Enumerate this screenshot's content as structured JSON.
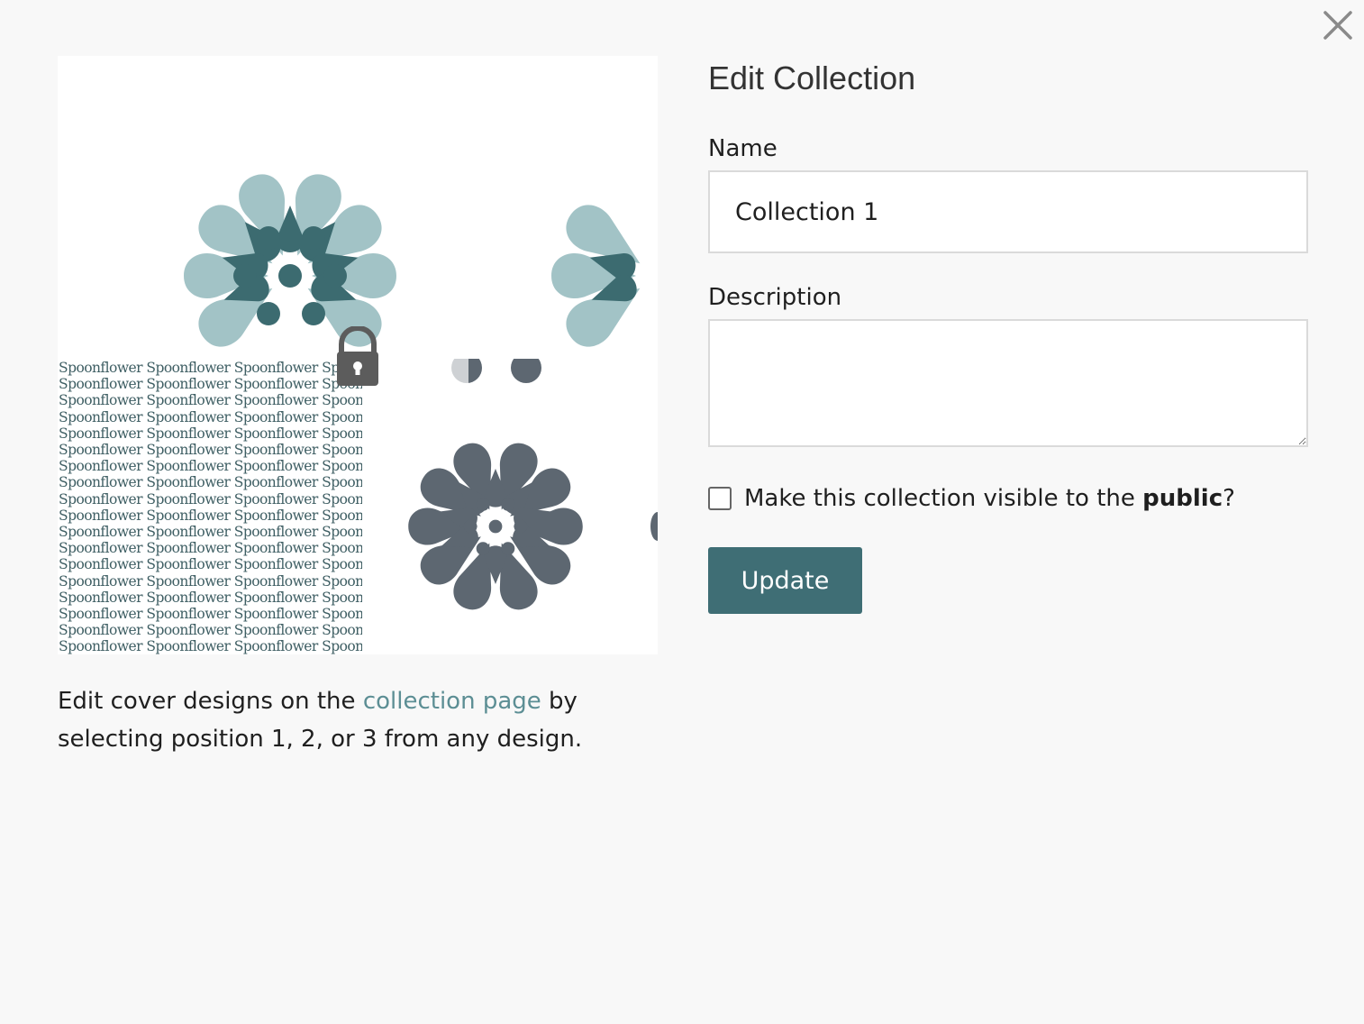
{
  "modal": {
    "close_icon": "close-icon"
  },
  "covers": {
    "pattern_text": "Spoonflower",
    "lock_icon": "lock-icon",
    "caption_prefix": "Edit cover designs on the ",
    "caption_link": "collection page",
    "caption_suffix": " by selecting position 1, 2, or 3 from any design."
  },
  "form": {
    "title": "Edit Collection",
    "name_label": "Name",
    "name_value": "Collection 1",
    "description_label": "Description",
    "description_value": "",
    "public_prefix": "Make this collection visible to the ",
    "public_bold": "public",
    "public_suffix": "?",
    "public_checked": false,
    "update_label": "Update"
  },
  "colors": {
    "accent": "#3f6e75",
    "link": "#5c8e94",
    "petal_light": "#a2c3c6",
    "petal_dark": "#3c6b70",
    "slate": "#5d6771",
    "background": "#f8f8f8"
  }
}
